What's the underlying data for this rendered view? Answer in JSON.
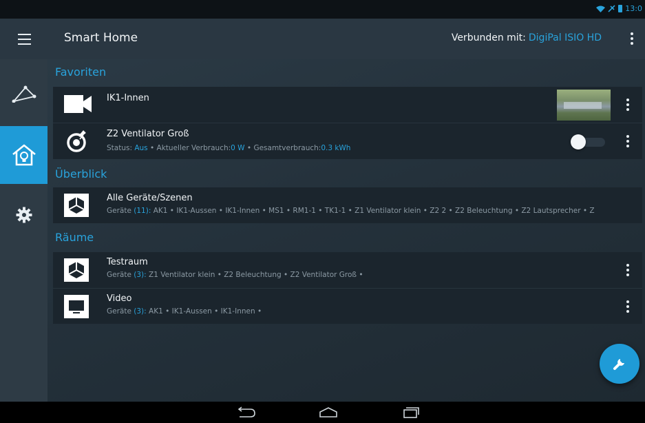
{
  "statusbar": {
    "time": "13:0"
  },
  "appbar": {
    "title": "Smart Home",
    "connected_label": "Verbunden mit:",
    "connected_device": "DigiPal ISIO HD"
  },
  "sections": {
    "favorites": {
      "title": "Favoriten",
      "items": [
        {
          "name": "IK1-Innen"
        },
        {
          "name": "Z2 Ventilator Groß",
          "status_label": "Status:",
          "status_value": "Aus",
          "usage_label": "Aktueller Verbrauch:",
          "usage_value": "0 W",
          "total_label": "Gesamtverbrauch:",
          "total_value": "0.3 kWh",
          "switch_on": false
        }
      ]
    },
    "overview": {
      "title": "Überblick",
      "item": {
        "name": "Alle Geräte/Szenen",
        "devices_label": "Geräte",
        "devices_count": "(11):",
        "devices": "AK1 • IK1-Aussen • IK1-Innen • MS1 • RM1-1 • TK1-1 • Z1 Ventilator klein • Z2 2 • Z2 Beleuchtung • Z2 Lautsprecher • Z"
      }
    },
    "rooms": {
      "title": "Räume",
      "items": [
        {
          "name": "Testraum",
          "devices_label": "Geräte",
          "devices_count": "(3):",
          "devices": "Z1 Ventilator klein • Z2 Beleuchtung • Z2 Ventilator Groß •"
        },
        {
          "name": "Video",
          "devices_label": "Geräte",
          "devices_count": "(3):",
          "devices": "AK1 • IK1-Aussen • IK1-Innen •"
        }
      ]
    }
  },
  "icons": {
    "sidenav": [
      "network-icon",
      "home-bulb-icon",
      "gear-icon"
    ],
    "fab": "wrench-icon"
  },
  "colors": {
    "accent": "#1f9bd7",
    "background": "#1f2a33",
    "card": "#1b252d"
  }
}
